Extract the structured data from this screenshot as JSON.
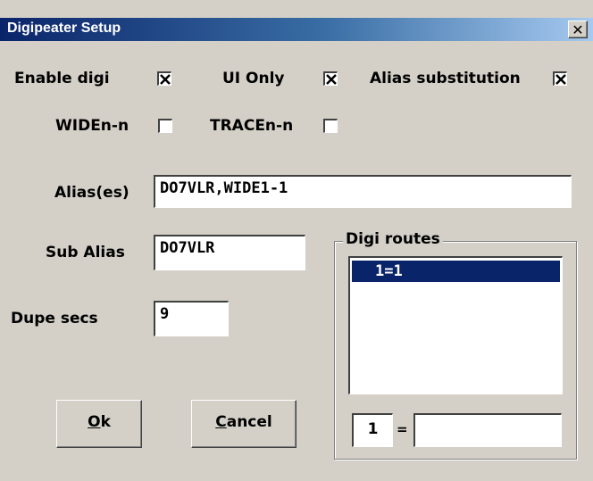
{
  "window": {
    "title": "Digipeater Setup",
    "close_glyph": "✕"
  },
  "options": {
    "enable_digi": {
      "label": "Enable digi",
      "checked": true
    },
    "ui_only": {
      "label": "UI Only",
      "checked": true
    },
    "alias_substitution": {
      "label": "Alias substitution",
      "checked": true
    },
    "widen_n": {
      "label": "WIDEn-n",
      "checked": false
    },
    "tracen_n": {
      "label": "TRACEn-n",
      "checked": false
    }
  },
  "fields": {
    "aliases": {
      "label": "Alias(es)",
      "value": "DO7VLR,WIDE1-1"
    },
    "sub_alias": {
      "label": "Sub Alias",
      "value": "DO7VLR"
    },
    "dupe_secs": {
      "label": "Dupe secs",
      "value": "9"
    }
  },
  "digi_routes": {
    "title": "Digi routes",
    "items": [
      "1=1"
    ],
    "selected_index": 0,
    "route_port": "1",
    "equals": "=",
    "route_value": ""
  },
  "buttons": {
    "ok": {
      "underlined": "O",
      "rest": "k"
    },
    "cancel": {
      "underlined": "C",
      "rest": "ancel"
    }
  }
}
